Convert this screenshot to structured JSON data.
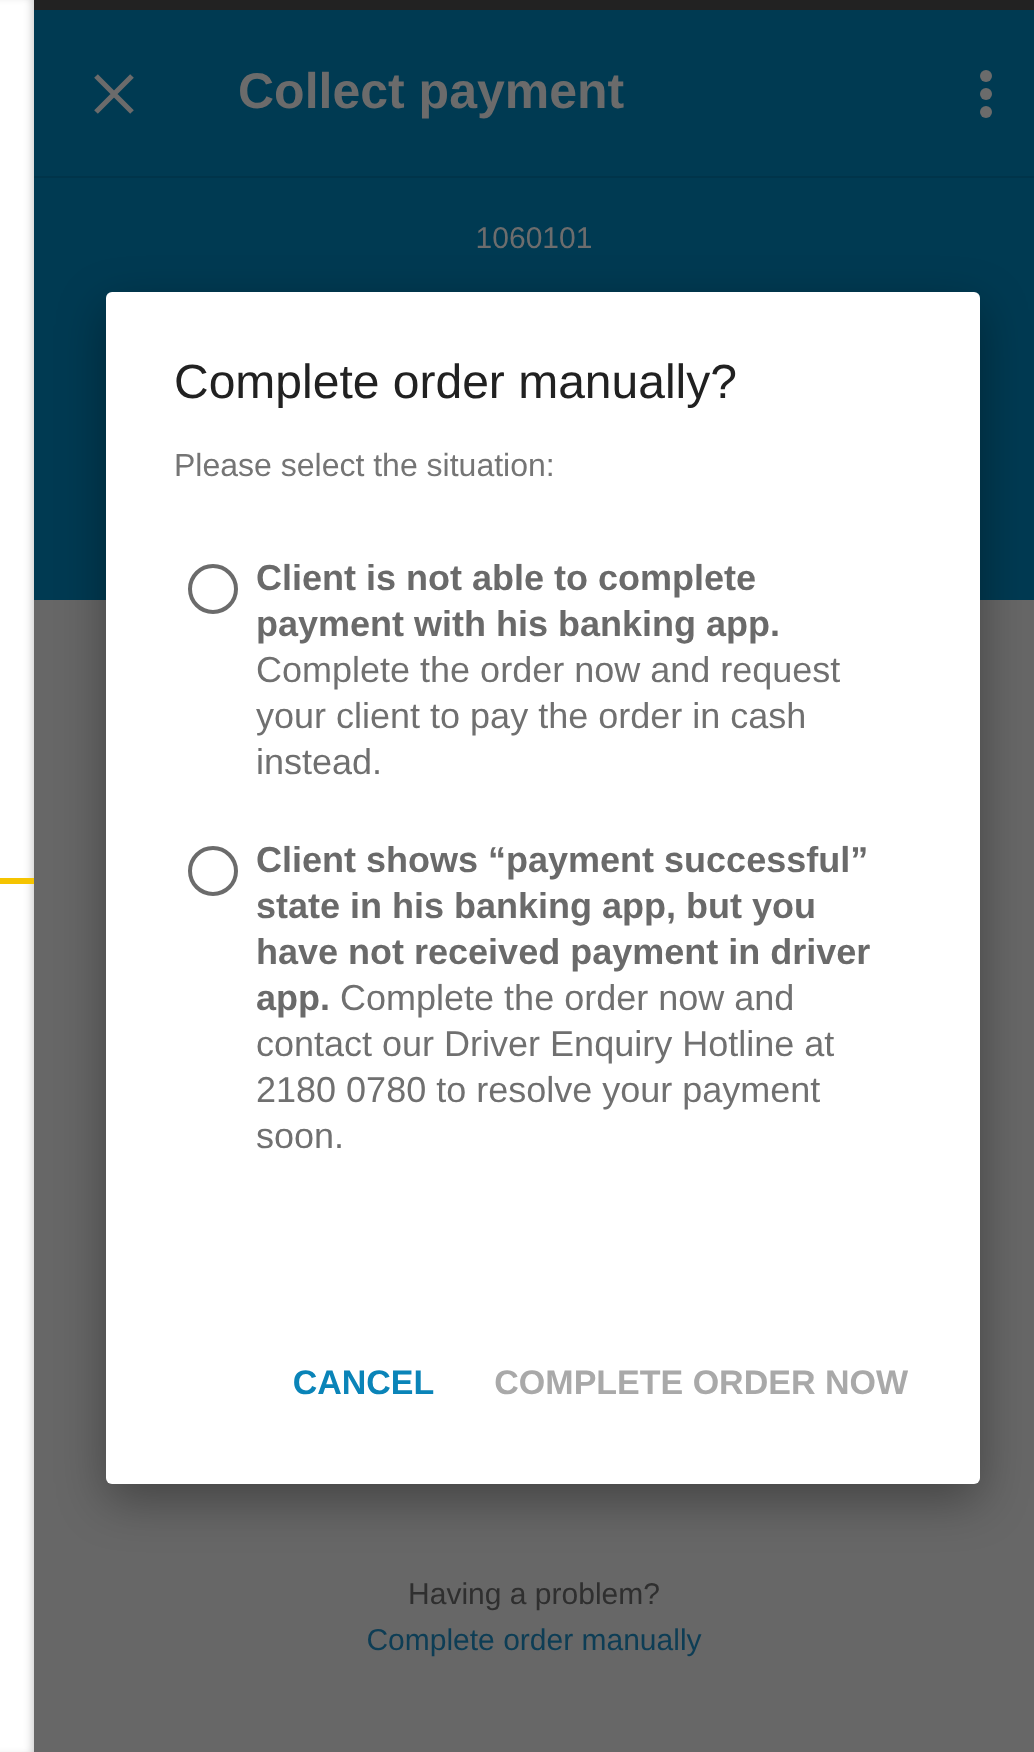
{
  "app_bar": {
    "title": "Collect payment"
  },
  "order": {
    "number": "1060101"
  },
  "footer": {
    "question": "Having a problem?",
    "link": "Complete order manually"
  },
  "dialog": {
    "title": "Complete order manually?",
    "subtitle": "Please select the situation:",
    "options": [
      {
        "text": "**Client is not able to complete payment with his banking app.** Complete the order now and request your client to pay the order in cash instead.",
        "selected": false
      },
      {
        "text": "**Client shows “payment successful” state in his banking app, but you have not received payment in driver app.** Complete the order now and contact our Driver Enquiry Hotline at 2180 0780 to resolve your payment soon.",
        "selected": false
      }
    ],
    "buttons": [
      {
        "label": "CANCEL",
        "disabled": false
      },
      {
        "label": "COMPLETE ORDER NOW",
        "disabled": true
      }
    ]
  }
}
